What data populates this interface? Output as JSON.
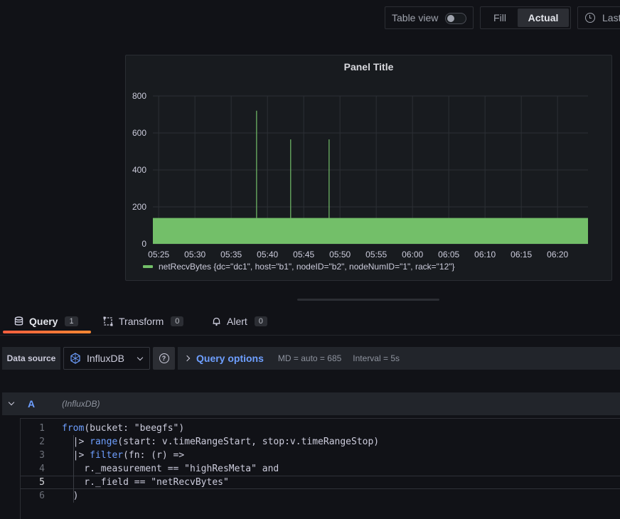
{
  "toolbar": {
    "table_view_label": "Table view",
    "table_view_on": false,
    "fill_label": "Fill",
    "actual_label": "Actual",
    "time_range_label": "Last"
  },
  "panel": {
    "title": "Panel Title"
  },
  "chart_data": {
    "type": "bar",
    "title": "Panel Title",
    "xlabel": "",
    "ylabel": "",
    "x_ticks": [
      "05:25",
      "05:30",
      "05:35",
      "05:40",
      "05:45",
      "05:50",
      "05:55",
      "06:00",
      "06:05",
      "06:10",
      "06:15",
      "06:20"
    ],
    "y_ticks": [
      0,
      200,
      400,
      600,
      800
    ],
    "ylim": [
      0,
      800
    ],
    "xlim_minutes": [
      -0.8,
      59.2
    ],
    "series": [
      {
        "name": "netRecvBytes {dc=\"dc1\", host=\"b1\", nodeID=\"b2\", nodeNumID=\"1\", rack=\"12\"}",
        "color": "#73bf69",
        "baseline_value": 140,
        "spikes": [
          {
            "t": "05:38.5",
            "minute": 13.5,
            "value": 720
          },
          {
            "t": "05:43.2",
            "minute": 18.2,
            "value": 565
          },
          {
            "t": "05:48.5",
            "minute": 23.5,
            "value": 565
          }
        ]
      }
    ],
    "grid": true,
    "legend": "bottom-left"
  },
  "tabs": [
    {
      "label": "Query",
      "count": "1",
      "icon": "database-icon",
      "active": true
    },
    {
      "label": "Transform",
      "count": "0",
      "icon": "transform-icon",
      "active": false
    },
    {
      "label": "Alert",
      "count": "0",
      "icon": "bell-icon",
      "active": false
    }
  ],
  "datasource": {
    "label": "Data source",
    "selected": "InfluxDB",
    "help": "?"
  },
  "query_options": {
    "title": "Query options",
    "md": "MD = auto = 685",
    "interval": "Interval = 5s"
  },
  "query": {
    "ref_id": "A",
    "datasource_name": "(InfluxDB)",
    "lines": [
      {
        "num": "1",
        "parts": [
          {
            "t": "from",
            "k": true
          },
          {
            "t": "(bucket: \"beegfs\")",
            "k": false
          }
        ]
      },
      {
        "num": "2",
        "parts": [
          {
            "t": "  |> ",
            "k": false
          },
          {
            "t": "range",
            "k": true
          },
          {
            "t": "(start: v.timeRangeStart, stop:v.timeRangeStop)",
            "k": false
          }
        ]
      },
      {
        "num": "3",
        "parts": [
          {
            "t": "  |> ",
            "k": false
          },
          {
            "t": "filter",
            "k": true
          },
          {
            "t": "(fn: (r) =>",
            "k": false
          }
        ]
      },
      {
        "num": "4",
        "parts": [
          {
            "t": "    r._measurement == \"highResMeta\" and",
            "k": false
          }
        ]
      },
      {
        "num": "5",
        "parts": [
          {
            "t": "    r._field == \"netRecvBytes\"",
            "k": false
          }
        ]
      },
      {
        "num": "6",
        "parts": [
          {
            "t": "  )",
            "k": false
          }
        ]
      }
    ],
    "current_line": "5"
  }
}
